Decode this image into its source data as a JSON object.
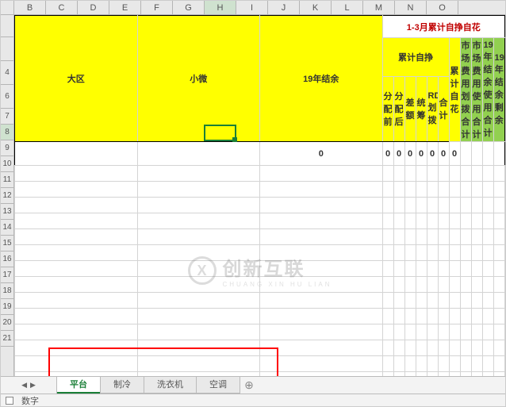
{
  "columns": [
    "B",
    "C",
    "D",
    "E",
    "F",
    "G",
    "H",
    "I",
    "J",
    "K",
    "L",
    "M",
    "N",
    "O"
  ],
  "active_col": "H",
  "active_row": "8",
  "row_labels_top": [
    "",
    "",
    "4",
    "6",
    "7",
    "8",
    "9",
    "10",
    "11",
    "12",
    "13",
    "14",
    "15",
    "16",
    "17",
    "18",
    "19",
    "20",
    "21"
  ],
  "header": {
    "big_region": "大区",
    "micro": "小微",
    "balance_19": "19年结余",
    "group_title": "1-3月累计自挣自花",
    "sub_group": "累计自挣",
    "cols": {
      "pre_alloc": "分配前",
      "post_alloc": "分配后",
      "diff": "差额",
      "tongchou": "统筹",
      "rdc": "RDC划拨",
      "heji": "合计",
      "zihua": "累计自花",
      "market_alloc_sum": "市场费用划拨合计",
      "market_use_sum": "市场费用使用合计",
      "bal19_use_sum": "19年结余使用合计",
      "bal19_remain": "19年结余剩余"
    }
  },
  "data_row": [
    "0",
    "0",
    "0",
    "0",
    "0",
    "0",
    "0",
    "0",
    "",
    "",
    "",
    ""
  ],
  "tabs": [
    "平台",
    "制冷",
    "洗衣机",
    "空调"
  ],
  "active_tab": 0,
  "add_tab_glyph": "⊕",
  "status": {
    "label": "数字"
  },
  "watermark": {
    "line1": "创新互联",
    "line2": "CHUANG XIN HU LIAN",
    "logo": "X"
  },
  "chart_data": null
}
